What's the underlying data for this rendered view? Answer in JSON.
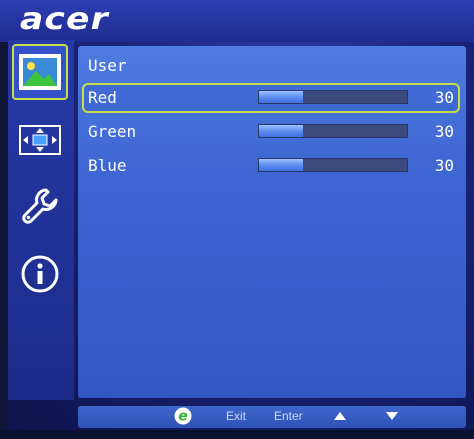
{
  "brand": {
    "logo": "acer"
  },
  "sidebar": {
    "tabs": [
      {
        "name": "picture",
        "icon": "picture-icon",
        "active": true
      },
      {
        "name": "position",
        "icon": "position-arrows-icon",
        "active": false
      },
      {
        "name": "settings",
        "icon": "wrench-icon",
        "active": false
      },
      {
        "name": "information",
        "icon": "info-icon",
        "active": false
      }
    ]
  },
  "panel": {
    "title": "User",
    "rows": [
      {
        "label": "Red",
        "value": "30",
        "level": 30,
        "selected": true
      },
      {
        "label": "Green",
        "value": "30",
        "level": 30,
        "selected": false
      },
      {
        "label": "Blue",
        "value": "30",
        "level": 30,
        "selected": false
      }
    ]
  },
  "footer": {
    "exit_label": "Exit",
    "enter_label": "Enter"
  },
  "colors": {
    "highlight": "#c7e04a",
    "panel": "#4470d8",
    "bar_fill": "#6f9cf4",
    "bar_track": "#3a4a7c",
    "e_key": "#3cc43c"
  }
}
